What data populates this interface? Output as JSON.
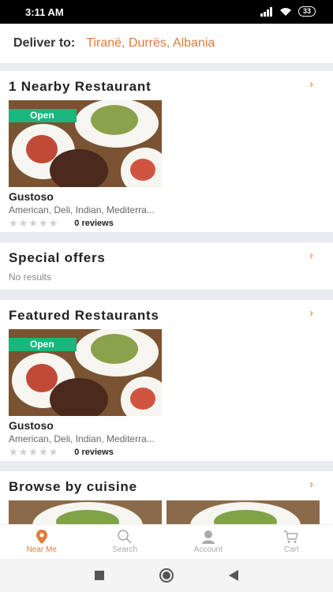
{
  "status_bar": {
    "time": "3:11 AM",
    "battery": "33"
  },
  "deliver": {
    "label": "Deliver to:",
    "location": "Tiranë, Durrës, Albania"
  },
  "nearby": {
    "title": "1 Nearby Restaurant",
    "restaurant": {
      "badge": "Open",
      "name": "Gustoso",
      "cuisines": "American, Deli, Indian, Mediterra...",
      "reviews": "0 reviews",
      "stars": "★★★★★"
    }
  },
  "special_offers": {
    "title": "Special offers",
    "empty_text": "No results"
  },
  "featured": {
    "title": "Featured Restaurants",
    "restaurant": {
      "badge": "Open",
      "name": "Gustoso",
      "cuisines": "American, Deli, Indian, Mediterra...",
      "reviews": "0 reviews",
      "stars": "★★★★★"
    }
  },
  "cuisine": {
    "title": "Browse by cuisine"
  },
  "chevron": "›",
  "bottom_nav": [
    {
      "label": "Near Me",
      "icon": "location-pin-icon",
      "active": true
    },
    {
      "label": "Search",
      "icon": "search-icon",
      "active": false
    },
    {
      "label": "Account",
      "icon": "account-icon",
      "active": false
    },
    {
      "label": "Cart",
      "icon": "cart-icon",
      "active": false
    }
  ],
  "colors": {
    "accent": "#e07b39",
    "open_badge": "#19b77b",
    "divider": "#e9ebee"
  }
}
